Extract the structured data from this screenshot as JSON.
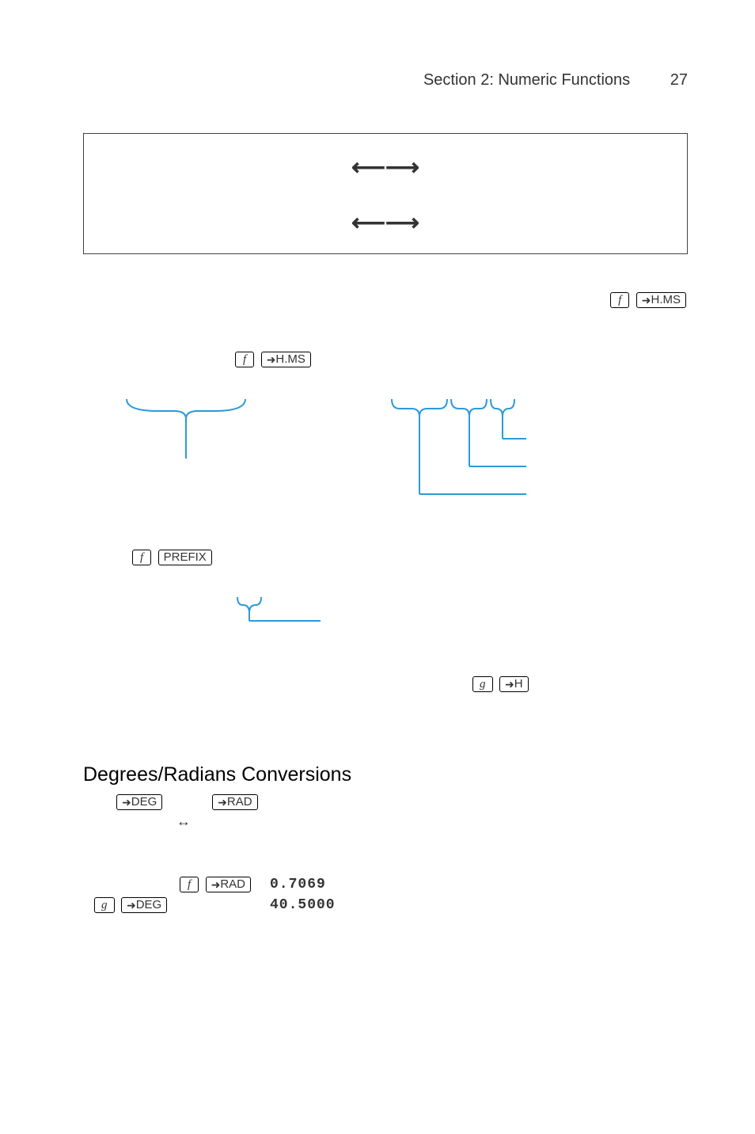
{
  "header": {
    "section": "Section 2: Numeric Functions",
    "page": "27"
  },
  "box": {
    "arrow1": "⟵⟶",
    "arrow2": "⟵⟶"
  },
  "keys": {
    "f": "f",
    "g": "g",
    "hms": "H.MS",
    "prefix": "PREFIX",
    "h": "H",
    "deg": "DEG",
    "rad": "RAD"
  },
  "heading": "Degrees/Radians Conversions",
  "doubleArrowSmall": "↔",
  "example": {
    "row1_result": "0.7069",
    "row2_result": "40.5000"
  }
}
